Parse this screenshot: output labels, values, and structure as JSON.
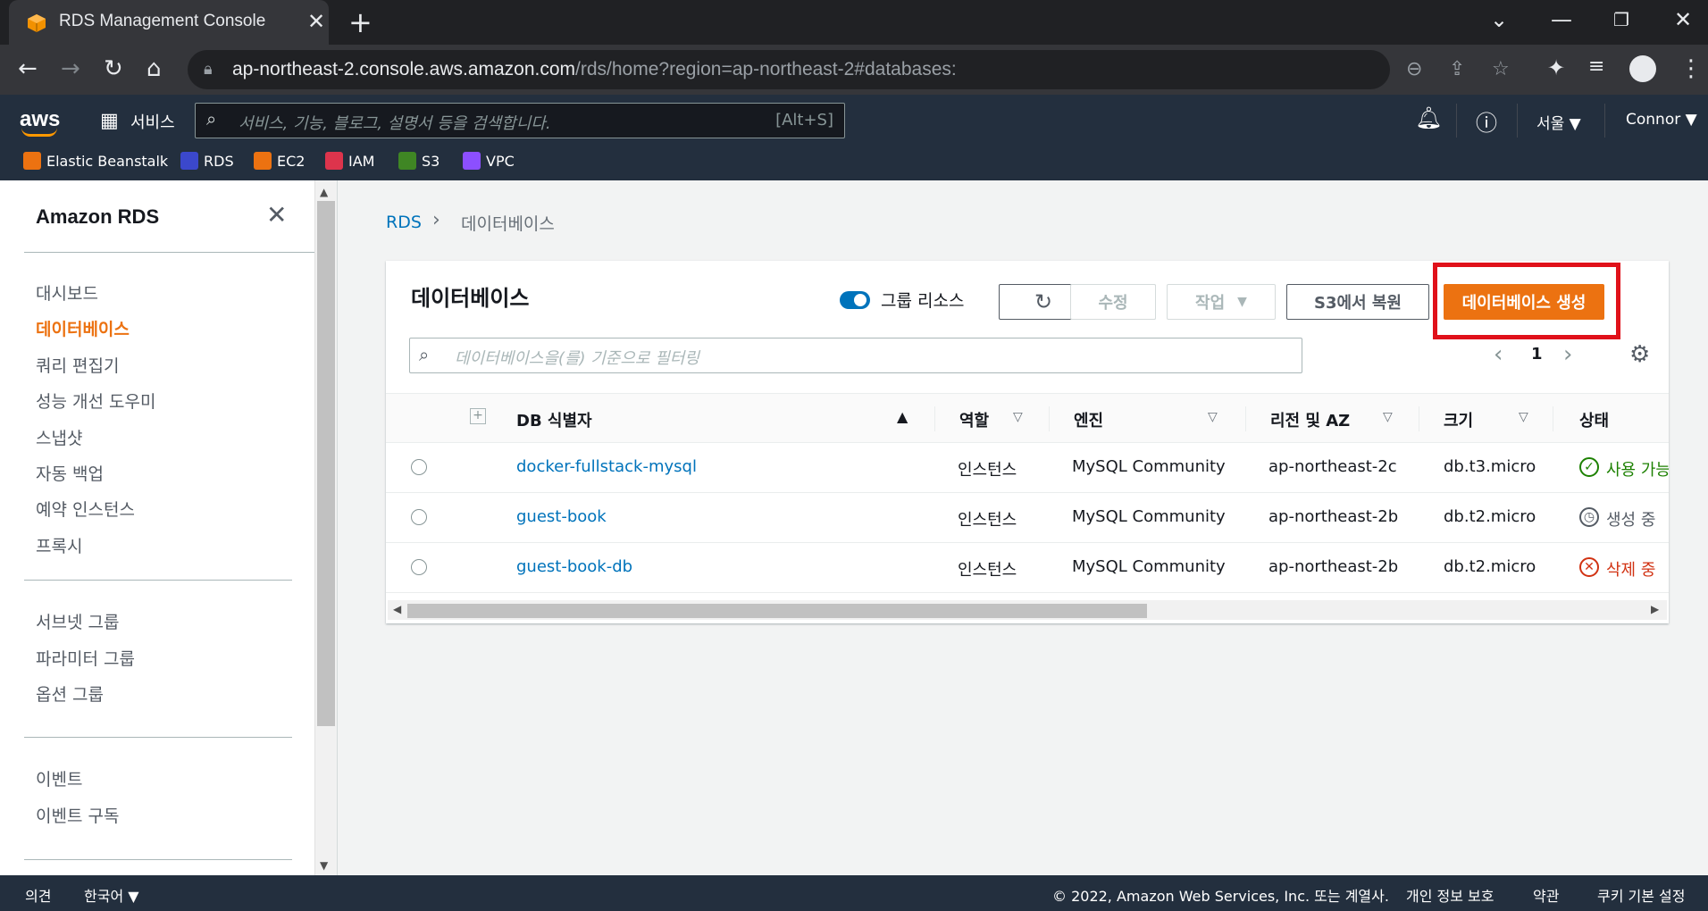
{
  "browser": {
    "tab_title": "RDS Management Console",
    "url_host": "ap-northeast-2.console.aws.amazon.com",
    "url_path": "/rds/home?region=ap-northeast-2#databases:"
  },
  "aws_header": {
    "logo": "aws",
    "services_label": "서비스",
    "search_placeholder": "서비스, 기능, 블로그, 설명서 등을 검색합니다.",
    "search_shortcut": "[Alt+S]",
    "region": "서울 ▼",
    "user": "Connor ▼",
    "favorites": [
      {
        "label": "Elastic Beanstalk",
        "color": "#ec7211"
      },
      {
        "label": "RDS",
        "color": "#3b48cc"
      },
      {
        "label": "EC2",
        "color": "#ec7211"
      },
      {
        "label": "IAM",
        "color": "#dd344c"
      },
      {
        "label": "S3",
        "color": "#3f8624"
      },
      {
        "label": "VPC",
        "color": "#8c4fff"
      }
    ]
  },
  "sidebar": {
    "title": "Amazon RDS",
    "group1": [
      "대시보드",
      "데이터베이스",
      "쿼리 편집기",
      "성능 개선 도우미",
      "스냅샷",
      "자동 백업",
      "예약 인스턴스",
      "프록시"
    ],
    "group2": [
      "서브넷 그룹",
      "파라미터 그룹",
      "옵션 그룹"
    ],
    "group3": [
      "이벤트",
      "이벤트 구독"
    ]
  },
  "breadcrumb": {
    "root": "RDS",
    "current": "데이터베이스"
  },
  "panel": {
    "title": "데이터베이스",
    "group_resources_label": "그룹 리소스",
    "modify_label": "수정",
    "actions_label": "작업",
    "restore_s3_label": "S3에서 복원",
    "create_label": "데이터베이스 생성",
    "filter_placeholder": "데이터베이스을(를) 기준으로 필터링",
    "page": "1"
  },
  "table": {
    "headers": {
      "id": "DB 식별자",
      "role": "역할",
      "engine": "엔진",
      "region": "리전 및 AZ",
      "size": "크기",
      "status": "상태"
    },
    "rows": [
      {
        "id": "docker-fullstack-mysql",
        "role": "인스턴스",
        "engine": "MySQL Community",
        "region": "ap-northeast-2c",
        "size": "db.t3.micro",
        "status": "사용 가능"
      },
      {
        "id": "guest-book",
        "role": "인스턴스",
        "engine": "MySQL Community",
        "region": "ap-northeast-2b",
        "size": "db.t2.micro",
        "status": "생성 중"
      },
      {
        "id": "guest-book-db",
        "role": "인스턴스",
        "engine": "MySQL Community",
        "region": "ap-northeast-2b",
        "size": "db.t2.micro",
        "status": "삭제 중"
      }
    ]
  },
  "footer": {
    "feedback": "의견",
    "language": "한국어 ▼",
    "copyright": "© 2022, Amazon Web Services, Inc. 또는 계열사.",
    "privacy": "개인 정보 보호",
    "terms": "약관",
    "cookies": "쿠키 기본 설정"
  }
}
